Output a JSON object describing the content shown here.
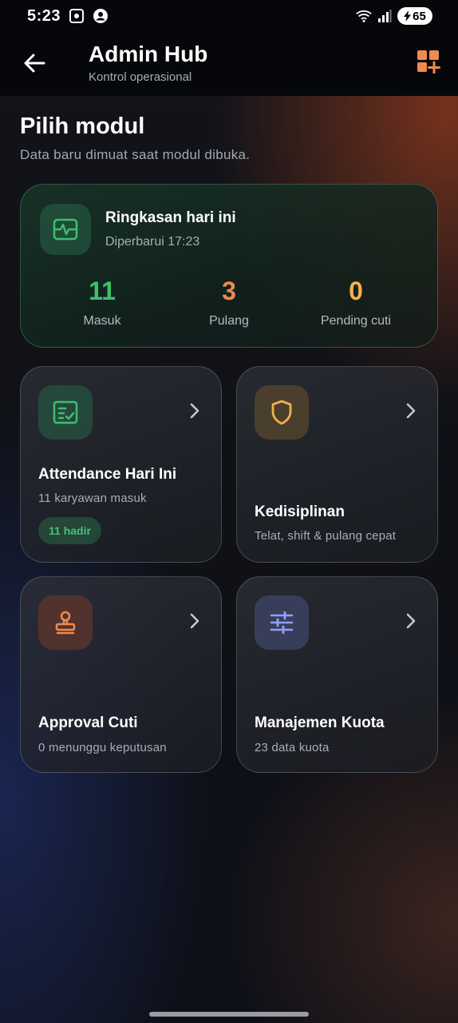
{
  "status_bar": {
    "time": "5:23",
    "battery": "65",
    "icons": [
      "screenshot-icon",
      "account-icon",
      "wifi-icon",
      "signal-icon",
      "battery-icon"
    ]
  },
  "app_bar": {
    "title": "Admin Hub",
    "subtitle": "Kontrol operasional",
    "back_icon": "arrow-left-icon",
    "action_icon": "grid-add-icon"
  },
  "page": {
    "title": "Pilih modul",
    "subtitle": "Data baru dimuat saat modul dibuka."
  },
  "summary": {
    "title": "Ringkasan hari ini",
    "updated": "Diperbarui 17:23",
    "icon": "activity-icon",
    "stats": [
      {
        "value": "11",
        "label": "Masuk",
        "color": "#3fbf6f"
      },
      {
        "value": "3",
        "label": "Pulang",
        "color": "#f08a4b"
      },
      {
        "value": "0",
        "label": "Pending cuti",
        "color": "#f2b04e"
      }
    ]
  },
  "modules": [
    {
      "title": "Attendance Hari Ini",
      "subtitle": "11 karyawan masuk",
      "badge": "11 hadir",
      "icon": "attendance-icon",
      "accent": "#3fbf6f"
    },
    {
      "title": "Kedisiplinan",
      "subtitle": "Telat, shift & pulang cepat",
      "icon": "shield-icon",
      "accent": "#f2b04e"
    },
    {
      "title": "Approval Cuti",
      "subtitle": "0 menunggu keputusan",
      "icon": "stamp-icon",
      "accent": "#f08a4b"
    },
    {
      "title": "Manajemen Kuota",
      "subtitle": "23 data kuota",
      "icon": "sliders-icon",
      "accent": "#8fa0ff"
    }
  ]
}
